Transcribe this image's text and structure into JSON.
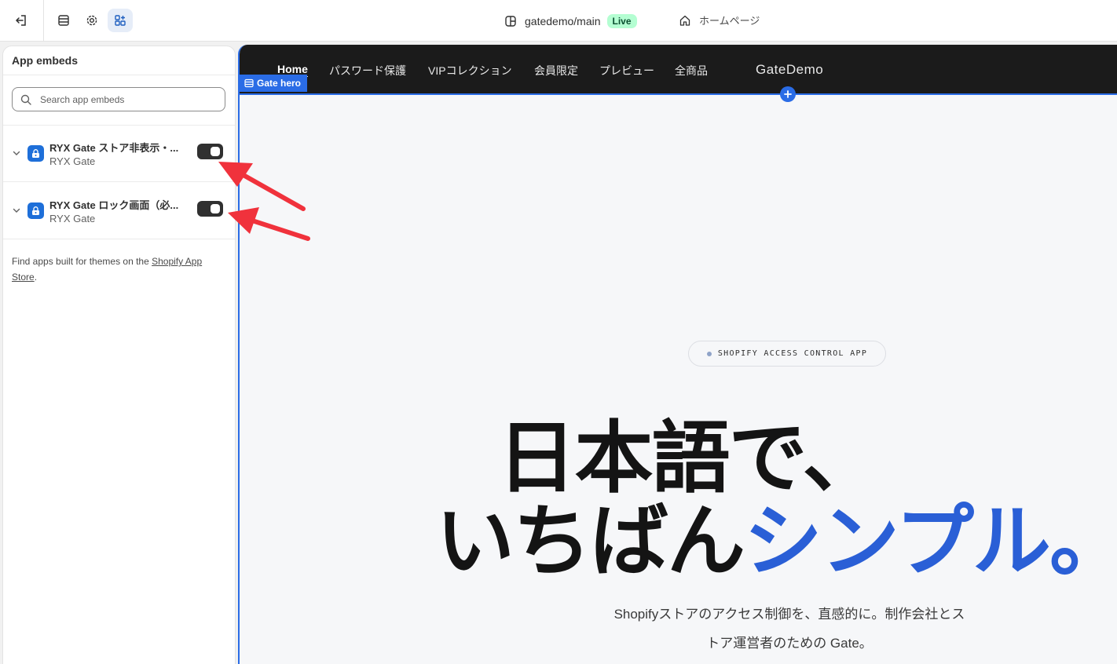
{
  "topbar": {
    "store_name": "gatedemo/main",
    "live_badge": "Live",
    "home_label": "ホームページ"
  },
  "sidebar": {
    "title": "App embeds",
    "search_placeholder": "Search app embeds",
    "embeds": [
      {
        "title": "RYX Gate ストア非表示・...",
        "subtitle": "RYX Gate",
        "enabled": true
      },
      {
        "title": "RYX Gate ロック画面（必...",
        "subtitle": "RYX Gate",
        "enabled": true
      }
    ],
    "footnote_prefix": "Find apps built for themes on the ",
    "footnote_link": "Shopify App Store",
    "footnote_suffix": "."
  },
  "preview": {
    "nav": [
      "Home",
      "パスワード保護",
      "VIPコレクション",
      "会員限定",
      "プレビュー",
      "全商品"
    ],
    "brand": "GateDemo",
    "section_tag": "Gate hero",
    "pill": "SHOPIFY ACCESS CONTROL APP",
    "headline_line1": "日本語で、",
    "headline_line2_a": "いちばん",
    "headline_line2_b": "シンプル。",
    "sub_line1": "Shopifyストアのアクセス制御を、直感的に。制作会社とス",
    "sub_line2": "トア運営者のための Gate。",
    "accent_color": "#2a5fd6",
    "selection_color": "#2a6ce6"
  },
  "annotation": {
    "arrow_color": "#f0323c"
  }
}
